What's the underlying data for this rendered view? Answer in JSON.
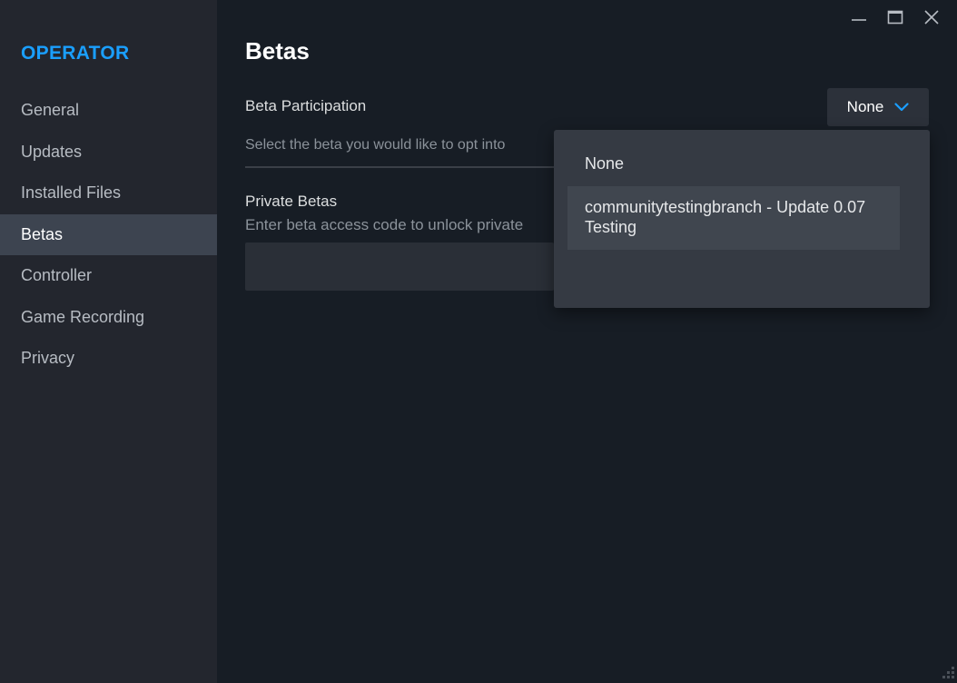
{
  "app": {
    "title": "OPERATOR"
  },
  "sidebar": {
    "items": [
      {
        "label": "General"
      },
      {
        "label": "Updates"
      },
      {
        "label": "Installed Files"
      },
      {
        "label": "Betas",
        "active": true
      },
      {
        "label": "Controller"
      },
      {
        "label": "Game Recording"
      },
      {
        "label": "Privacy"
      }
    ]
  },
  "window_controls": {
    "icons": [
      "minimize-icon",
      "maximize-icon",
      "close-icon"
    ]
  },
  "main": {
    "title": "Betas",
    "beta_participation": {
      "label": "Beta Participation",
      "description": "Select the beta you would like to opt into",
      "selected": "None"
    },
    "private_betas": {
      "label": "Private Betas",
      "description": "Enter beta access code to unlock private",
      "input_value": ""
    }
  },
  "dropdown": {
    "options": [
      {
        "line1": "None",
        "line2": ""
      },
      {
        "line1": "communitytestingbranch - Update 0.07",
        "line2": "Testing"
      }
    ]
  },
  "colors": {
    "accent": "#1a9fff",
    "sidebar_bg": "#23262e",
    "main_bg": "#171d25",
    "active_item_bg": "#3d4450",
    "menu_bg": "#353a43"
  }
}
